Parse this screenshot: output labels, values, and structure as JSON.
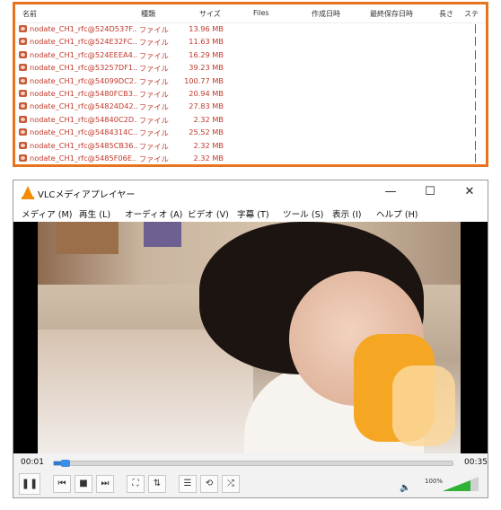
{
  "file_list": {
    "columns": [
      "名前",
      "種類",
      "サイズ",
      "Files",
      "作成日時",
      "最終保存日時",
      "長さ",
      "ステ"
    ],
    "rows": [
      {
        "name": "nodate_CH1_rfc@524D537F...",
        "type": "ファイル",
        "size": "13.96 MB"
      },
      {
        "name": "nodate_CH1_rfc@524E32FC...",
        "type": "ファイル",
        "size": "11.63 MB"
      },
      {
        "name": "nodate_CH1_rfc@524EEEA4...",
        "type": "ファイル",
        "size": "16.29 MB"
      },
      {
        "name": "nodate_CH1_rfc@53257DF1...",
        "type": "ファイル",
        "size": "39.23 MB"
      },
      {
        "name": "nodate_CH1_rfc@54099DC2...",
        "type": "ファイル",
        "size": "100.77 MB"
      },
      {
        "name": "nodate_CH1_rfc@5480FCB3...",
        "type": "ファイル",
        "size": "20.94 MB"
      },
      {
        "name": "nodate_CH1_rfc@54824D42...",
        "type": "ファイル",
        "size": "27.83 MB"
      },
      {
        "name": "nodate_CH1_rfc@54840C2D...",
        "type": "ファイル",
        "size": "2.32 MB"
      },
      {
        "name": "nodate_CH1_rfc@5484314C...",
        "type": "ファイル",
        "size": "25.52 MB"
      },
      {
        "name": "nodate_CH1_rfc@5485CB36...",
        "type": "ファイル",
        "size": "2.32 MB"
      },
      {
        "name": "nodate_CH1_rfc@5485F06E...",
        "type": "ファイル",
        "size": "2.32 MB"
      }
    ]
  },
  "vlc": {
    "title": "VLCメディアプレイヤー",
    "window_buttons": {
      "minimize": "—",
      "maximize": "☐",
      "close": "✕"
    },
    "menu": [
      "メディア (M)",
      "再生 (L)",
      "オーディオ (A)",
      "ビデオ (V)",
      "字幕 (T)",
      "ツール (S)",
      "表示 (I)",
      "ヘルプ (H)"
    ],
    "time_elapsed": "00:01",
    "time_total": "00:35",
    "progress_fraction": 0.03,
    "volume_label": "100%",
    "volume_fraction": 0.78,
    "buttons": {
      "pause": "❚❚",
      "prev": "⏮",
      "stop": "■",
      "next": "⏭",
      "fullscreen": "⛶",
      "extended": "⇅",
      "playlist": "☰",
      "loop": "⟲",
      "shuffle": "⤮"
    },
    "icons": {
      "volume": "🔈"
    },
    "colors": {
      "accent": "#e8731f",
      "progress": "#2b7bd6",
      "volume": "#2fb134"
    }
  }
}
